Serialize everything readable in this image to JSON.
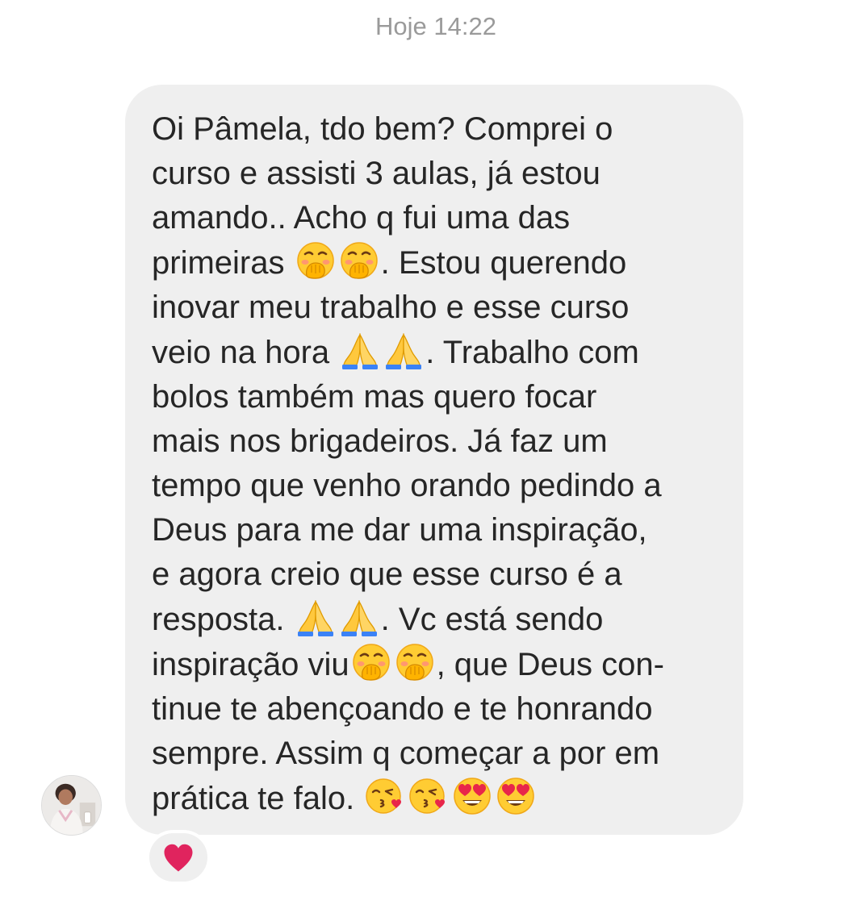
{
  "header": {
    "timestamp": "Hoje 14:22"
  },
  "message": {
    "lines": [
      [
        {
          "text": "Oi Pâmela, tdo bem? Comprei o"
        }
      ],
      [
        {
          "text": "curso e assisti 3 aulas, já estou"
        }
      ],
      [
        {
          "text": "amando.. Acho q fui uma das"
        }
      ],
      [
        {
          "text": "primeiras "
        },
        {
          "emoji": "hand-over-mouth-emoji"
        },
        {
          "emoji": "hand-over-mouth-emoji"
        },
        {
          "text": ". Estou querendo"
        }
      ],
      [
        {
          "text": "inovar meu trabalho e esse curso"
        }
      ],
      [
        {
          "text": "veio na hora "
        },
        {
          "emoji": "folded-hands-emoji"
        },
        {
          "emoji": "folded-hands-emoji"
        },
        {
          "text": ". Trabalho com"
        }
      ],
      [
        {
          "text": "bolos também mas quero focar"
        }
      ],
      [
        {
          "text": "mais nos brigadeiros. Já faz um"
        }
      ],
      [
        {
          "text": "tempo que venho orando pedindo a"
        }
      ],
      [
        {
          "text": "Deus para me dar uma inspiração,"
        }
      ],
      [
        {
          "text": "e agora creio que esse curso é a"
        }
      ],
      [
        {
          "text": "resposta. "
        },
        {
          "emoji": "folded-hands-emoji"
        },
        {
          "emoji": "folded-hands-emoji"
        },
        {
          "text": ". Vc está sendo"
        }
      ],
      [
        {
          "text": "inspiração viu"
        },
        {
          "emoji": "hand-over-mouth-emoji"
        },
        {
          "emoji": "hand-over-mouth-emoji"
        },
        {
          "text": ", que Deus con-"
        }
      ],
      [
        {
          "text": "tinue te abençoando e te honrando"
        }
      ],
      [
        {
          "text": "sempre. Assim q começar a por em"
        }
      ],
      [
        {
          "text": "prática te falo. "
        },
        {
          "emoji": "face-blowing-kiss-emoji"
        },
        {
          "emoji": "face-blowing-kiss-emoji"
        },
        {
          "emoji": "heart-eyes-emoji"
        },
        {
          "emoji": "heart-eyes-emoji"
        }
      ]
    ]
  },
  "sender": {
    "avatar_icon": "avatar"
  },
  "reaction": {
    "icon": "heart-reaction-icon",
    "color": "#e0245e"
  },
  "colors": {
    "bubble": "#efefef",
    "text": "#262626",
    "timestamp": "#9a9a9a"
  }
}
